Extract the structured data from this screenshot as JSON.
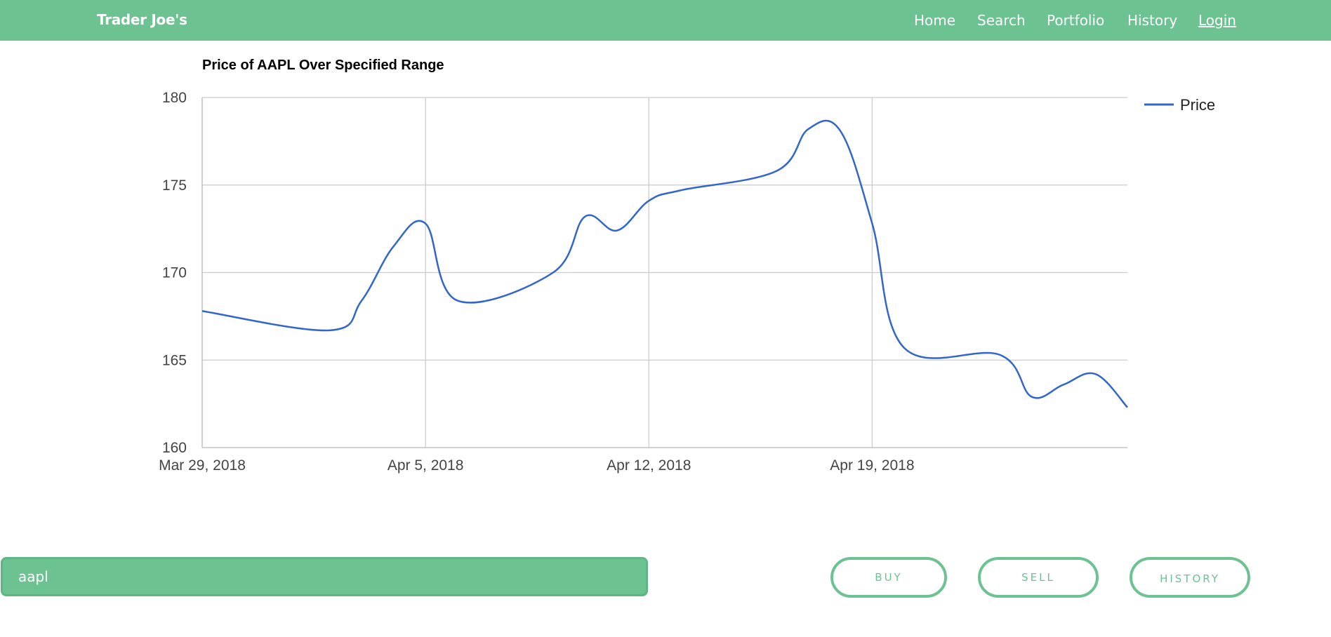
{
  "navbar": {
    "brand": "Trader Joe's",
    "links": [
      "Home",
      "Search",
      "Portfolio",
      "History",
      "Login"
    ],
    "background": "#6cc291"
  },
  "chart_data": {
    "type": "line",
    "title": "Price of AAPL Over Specified Range",
    "xlabel": "",
    "ylabel": "",
    "ylim": [
      160,
      180
    ],
    "yticks": [
      160,
      165,
      170,
      175,
      180
    ],
    "xticks": [
      "Mar 29, 2018",
      "Apr 5, 2018",
      "Apr 12, 2018",
      "Apr 19, 2018"
    ],
    "xrange_days": [
      0,
      29
    ],
    "xtick_days": [
      0,
      7,
      14,
      21
    ],
    "grid": true,
    "legend_position": "right",
    "series": [
      {
        "name": "Price",
        "color": "#3366cc",
        "x": [
          "Mar 29, 2018",
          "Apr 2, 2018",
          "Apr 3, 2018",
          "Apr 4, 2018",
          "Apr 5, 2018",
          "Apr 6, 2018",
          "Apr 9, 2018",
          "Apr 10, 2018",
          "Apr 11, 2018",
          "Apr 12, 2018",
          "Apr 13, 2018",
          "Apr 16, 2018",
          "Apr 17, 2018",
          "Apr 18, 2018",
          "Apr 19, 2018",
          "Apr 20, 2018",
          "Apr 23, 2018",
          "Apr 24, 2018",
          "Apr 25, 2018",
          "Apr 26, 2018",
          "Apr 27, 2018"
        ],
        "values": [
          167.8,
          166.7,
          168.4,
          171.5,
          172.8,
          168.4,
          170.0,
          173.2,
          172.4,
          174.1,
          174.7,
          175.8,
          178.2,
          178.1,
          172.8,
          165.7,
          165.3,
          162.9,
          163.6,
          164.2,
          162.3
        ]
      }
    ]
  },
  "search": {
    "value": "aapl"
  },
  "buttons": {
    "buy": "BUY",
    "sell": "SELL",
    "history": "HISTORY"
  }
}
